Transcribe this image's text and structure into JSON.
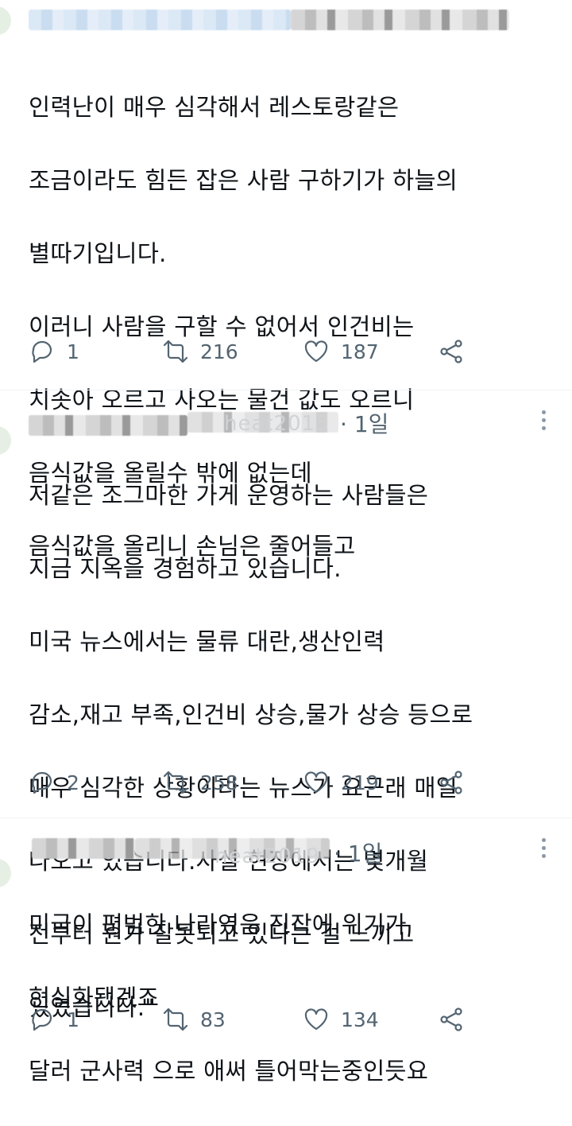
{
  "tweets": [
    {
      "handle_fragment": "",
      "time": "",
      "lines": [
        "인력난이 매우 심각해서 레스토랑같은",
        "조금이라도 힘든 잡은 사람 구하기가 하늘의",
        "별따기입니다.",
        "이러니 사람을 구할 수 없어서 인건비는",
        "치솟아 오르고 사오는 물건 값도 오르니",
        "음식값을 올릴수 밖에 없는데",
        "음식값을 올리니 손님은 줄어들고"
      ],
      "replies": "1",
      "retweets": "216",
      "likes": "187"
    },
    {
      "handle_fragment": "heat2015",
      "time": "· 1일",
      "lines": [
        "저같은 조그마한 가게 운영하는 사람들은",
        "지금 지옥을 경험하고 있습니다.",
        "미국 뉴스에서는 물류 대란,생산인력",
        "감소,재고 부족,인건비 상승,물가 상승 등으로",
        "매우 심각한 상황이라는 뉴스가 요근래 매일",
        "나오고 있습니다.사실 현장에서는 몇개월",
        "전부터 뭔가 잘못되고 있다는 걸 느끼고",
        "있었습니다.\""
      ],
      "replies": "2",
      "retweets": "258",
      "likes": "219"
    },
    {
      "handle_fragment": "heat2019",
      "time": "· 1일",
      "lines": [
        "미국이 평범한 나라였음 진작에 위기가",
        "현실화됐겠죠",
        "달러 군사력 으로 애써 틀어막는중인듯요"
      ],
      "replies": "1",
      "retweets": "83",
      "likes": "134"
    }
  ],
  "icons": {
    "reply": "reply-icon",
    "retweet": "retweet-icon",
    "like": "heart-icon",
    "share": "share-icon",
    "more": "more-icon"
  },
  "colors": {
    "text": "#0f1419",
    "muted": "#536471",
    "divider": "#eff3f4"
  }
}
